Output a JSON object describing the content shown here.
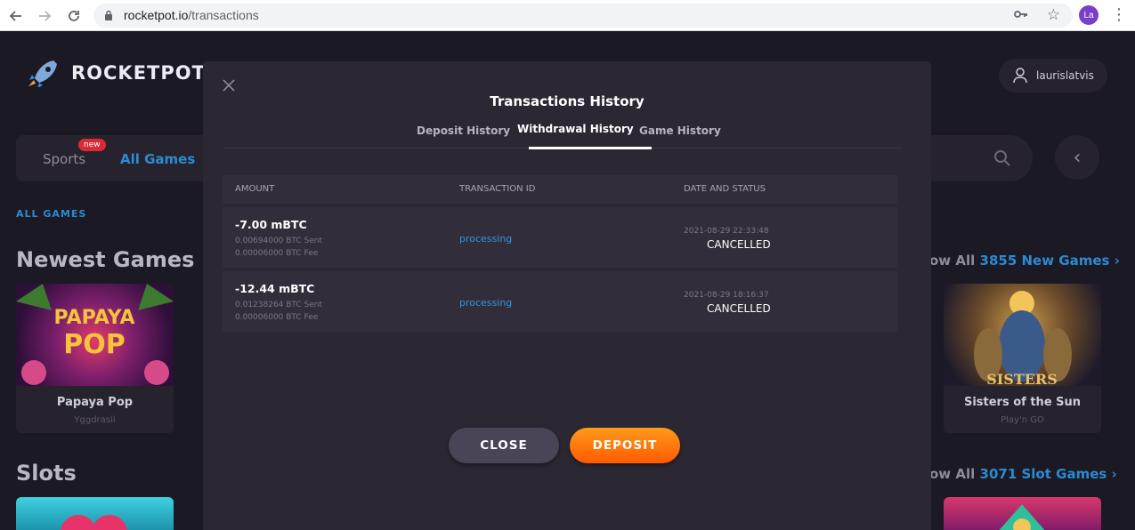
{
  "browser": {
    "url_domain": "rocketpot.io",
    "url_path": "/transactions",
    "profile_initials": "La",
    "icons": [
      "back-arrow-icon",
      "forward-arrow-icon",
      "reload-icon",
      "lock-icon",
      "key-icon",
      "star-icon",
      "kebab-menu-icon"
    ]
  },
  "site": {
    "logo_text": "ROCKETPOT",
    "username": "laurislatvis",
    "tabs": {
      "sports": "Sports",
      "sports_badge": "new",
      "all_games": "All Games"
    },
    "all_games_label": "ALL GAMES",
    "sections": {
      "newest": {
        "title": "Newest Games",
        "show_all_prefix": "ow All",
        "show_all_count": "3855 New Games"
      },
      "slots": {
        "title": "Slots",
        "show_all_prefix": "ow All",
        "show_all_count": "3071 Slot Games"
      }
    },
    "games": [
      {
        "name": "Papaya Pop",
        "provider": "Yggdrasil"
      },
      {
        "name": "Sisters of the Sun",
        "provider": "Play'n GO"
      }
    ]
  },
  "modal": {
    "title": "Transactions History",
    "tabs": [
      "Deposit History",
      "Withdrawal History",
      "Game History"
    ],
    "active_tab": "Withdrawal History",
    "columns": [
      "AMOUNT",
      "TRANSACTION ID",
      "DATE AND STATUS"
    ],
    "rows": [
      {
        "amount": "-7.00 mBTC",
        "sent": "0.00694000 BTC Sent",
        "fee": "0.00006000 BTC Fee",
        "transaction_id": "processing",
        "date": "2021-08-29 22:33:48",
        "status": "CANCELLED"
      },
      {
        "amount": "-12.44 mBTC",
        "sent": "0.01238264 BTC Sent",
        "fee": "0.00006000 BTC Fee",
        "transaction_id": "processing",
        "date": "2021-08-29 18:16:37",
        "status": "CANCELLED"
      }
    ],
    "close_label": "CLOSE",
    "deposit_label": "DEPOSIT"
  },
  "colors": {
    "accent_blue": "#2b8bd1",
    "deposit_orange": "#ff7a0e",
    "modal_bg": "#2b2733",
    "page_bg": "#1b1923"
  }
}
